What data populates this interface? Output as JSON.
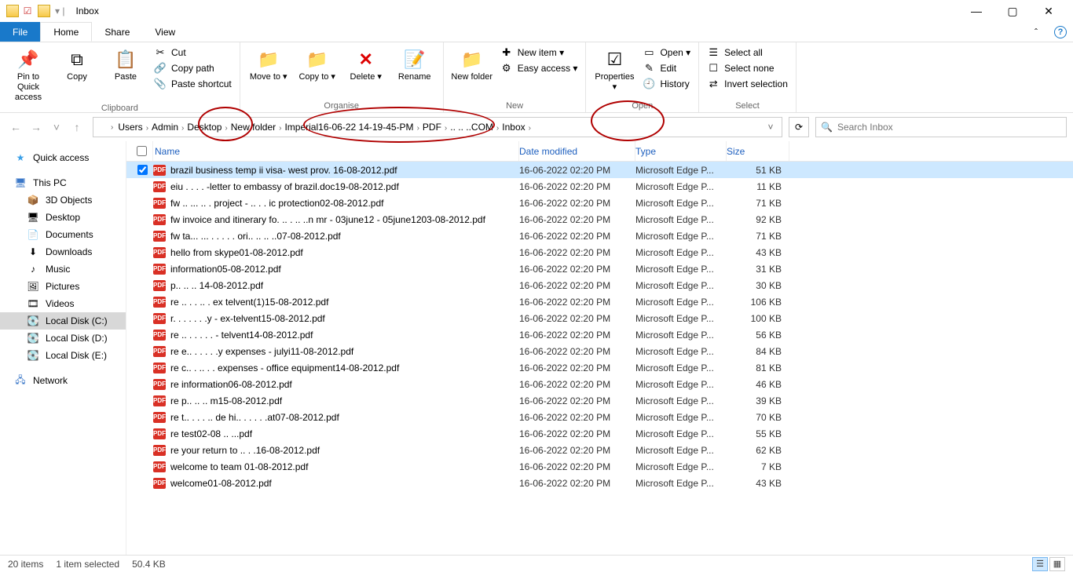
{
  "window": {
    "title": "Inbox",
    "controls": {
      "min": "—",
      "max": "▢",
      "close": "✕"
    }
  },
  "tabs": {
    "file": "File",
    "home": "Home",
    "share": "Share",
    "view": "View"
  },
  "ribbon": {
    "clipboard": {
      "label": "Clipboard",
      "pin": "Pin to Quick access",
      "copy": "Copy",
      "paste": "Paste",
      "cut": "Cut",
      "copy_path": "Copy path",
      "paste_shortcut": "Paste shortcut"
    },
    "organise": {
      "label": "Organise",
      "move_to": "Move to ▾",
      "copy_to": "Copy to ▾",
      "delete": "Delete ▾",
      "rename": "Rename"
    },
    "new": {
      "label": "New",
      "new_folder": "New folder",
      "new_item": "New item ▾",
      "easy_access": "Easy access ▾"
    },
    "open": {
      "label": "Open",
      "properties": "Properties ▾",
      "open": "Open ▾",
      "edit": "Edit",
      "history": "History"
    },
    "select": {
      "label": "Select",
      "select_all": "Select all",
      "select_none": "Select none",
      "invert": "Invert selection"
    }
  },
  "breadcrumbs": [
    "Users",
    "Admin",
    "Desktop",
    "New folder",
    "Imperial16-06-22 14-19-45-PM",
    "PDF",
    "..    .. ..COM",
    "Inbox"
  ],
  "search": {
    "placeholder": "Search Inbox"
  },
  "sidebar": {
    "quick_access": "Quick access",
    "this_pc": "This PC",
    "items": [
      "3D Objects",
      "Desktop",
      "Documents",
      "Downloads",
      "Music",
      "Pictures",
      "Videos",
      "Local Disk (C:)",
      "Local Disk (D:)",
      "Local Disk (E:)"
    ],
    "network": "Network"
  },
  "columns": {
    "name": "Name",
    "date": "Date modified",
    "type": "Type",
    "size": "Size"
  },
  "files": [
    {
      "name": "brazil business temp ii visa- west prov. 16-08-2012.pdf",
      "date": "16-06-2022 02:20 PM",
      "type": "Microsoft Edge P...",
      "size": "51 KB",
      "selected": true
    },
    {
      "name": "eiu .  .  .   . -letter to embassy of brazil.doc19-08-2012.pdf",
      "date": "16-06-2022 02:20 PM",
      "type": "Microsoft Edge P...",
      "size": "11 KB"
    },
    {
      "name": "fw .. ... .. . project - .. . . ic protection02-08-2012.pdf",
      "date": "16-06-2022 02:20 PM",
      "type": "Microsoft Edge P...",
      "size": "71 KB"
    },
    {
      "name": "fw invoice and itinerary fo. .. . .. ..n mr - 03june12 - 05june1203-08-2012.pdf",
      "date": "16-06-2022 02:20 PM",
      "type": "Microsoft Edge P...",
      "size": "92 KB"
    },
    {
      "name": "fw ta... ... . . . .  . ori.. .. .. ..07-08-2012.pdf",
      "date": "16-06-2022 02:20 PM",
      "type": "Microsoft Edge P...",
      "size": "71 KB"
    },
    {
      "name": "hello from skype01-08-2012.pdf",
      "date": "16-06-2022 02:20 PM",
      "type": "Microsoft Edge P...",
      "size": "43 KB"
    },
    {
      "name": "information05-08-2012.pdf",
      "date": "16-06-2022 02:20 PM",
      "type": "Microsoft Edge P...",
      "size": "31 KB"
    },
    {
      "name": "p.. .. ..  14-08-2012.pdf",
      "date": "16-06-2022 02:20 PM",
      "type": "Microsoft Edge P...",
      "size": "30 KB"
    },
    {
      "name": "re .. . . .. . ex  telvent(1)15-08-2012.pdf",
      "date": "16-06-2022 02:20 PM",
      "type": "Microsoft Edge P...",
      "size": "106 KB"
    },
    {
      "name": "r. . . . . . .y - ex-telvent15-08-2012.pdf",
      "date": "16-06-2022 02:20 PM",
      "type": "Microsoft Edge P...",
      "size": "100 KB"
    },
    {
      "name": "re .. . . . . . - telvent14-08-2012.pdf",
      "date": "16-06-2022 02:20 PM",
      "type": "Microsoft Edge P...",
      "size": "56 KB"
    },
    {
      "name": "re e.. . . . . .y expenses - julyi11-08-2012.pdf",
      "date": "16-06-2022 02:20 PM",
      "type": "Microsoft Edge P...",
      "size": "84 KB"
    },
    {
      "name": "re c.. . .. . . expenses - office equipment14-08-2012.pdf",
      "date": "16-06-2022 02:20 PM",
      "type": "Microsoft Edge P...",
      "size": "81 KB"
    },
    {
      "name": "re information06-08-2012.pdf",
      "date": "16-06-2022 02:20 PM",
      "type": "Microsoft Edge P...",
      "size": "46 KB"
    },
    {
      "name": "re p.. .. .. m15-08-2012.pdf",
      "date": "16-06-2022 02:20 PM",
      "type": "Microsoft Edge P...",
      "size": "39 KB"
    },
    {
      "name": "re t.. . . . .. de hi.. . . . . .at07-08-2012.pdf",
      "date": "16-06-2022 02:20 PM",
      "type": "Microsoft Edge P...",
      "size": "70 KB"
    },
    {
      "name": "re test02-08 .. ...pdf",
      "date": "16-06-2022 02:20 PM",
      "type": "Microsoft Edge P...",
      "size": "55 KB"
    },
    {
      "name": "re your return to  .. .  .16-08-2012.pdf",
      "date": "16-06-2022 02:20 PM",
      "type": "Microsoft Edge P...",
      "size": "62 KB"
    },
    {
      "name": "welcome to team 01-08-2012.pdf",
      "date": "16-06-2022 02:20 PM",
      "type": "Microsoft Edge P...",
      "size": "7 KB"
    },
    {
      "name": "welcome01-08-2012.pdf",
      "date": "16-06-2022 02:20 PM",
      "type": "Microsoft Edge P...",
      "size": "43 KB"
    }
  ],
  "status": {
    "count": "20 items",
    "selected": "1 item selected",
    "size": "50.4 KB"
  }
}
